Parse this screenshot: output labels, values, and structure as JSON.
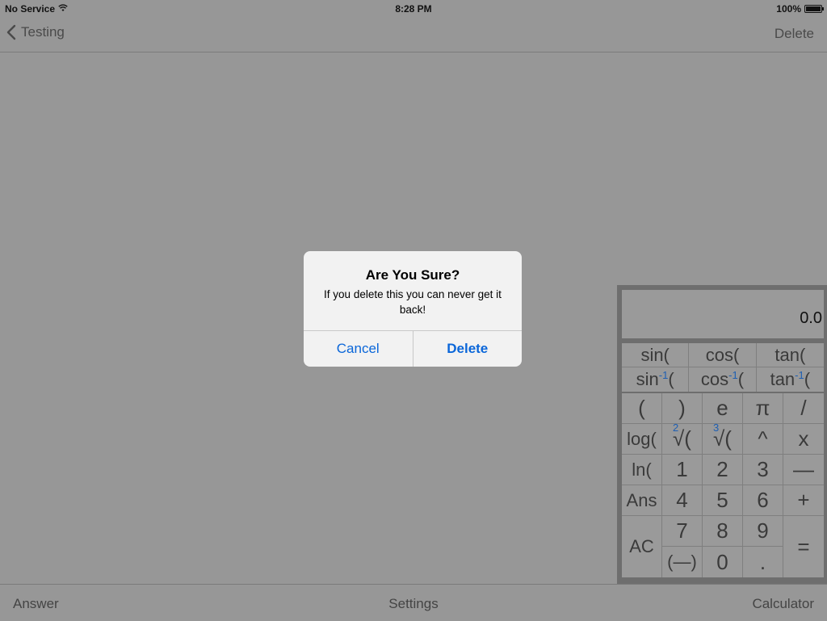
{
  "status_bar": {
    "carrier": "No Service",
    "time": "8:28 PM",
    "battery": "100%"
  },
  "nav": {
    "back_label": "Testing",
    "right_action": "Delete"
  },
  "calculator": {
    "display": "0.0",
    "trig": [
      {
        "fn": "sin(",
        "sup": ""
      },
      {
        "fn": "cos(",
        "sup": ""
      },
      {
        "fn": "tan(",
        "sup": ""
      },
      {
        "fn": "sin",
        "sup": "-1",
        "tail": "("
      },
      {
        "fn": "cos",
        "sup": "-1",
        "tail": "("
      },
      {
        "fn": "tan",
        "sup": "-1",
        "tail": "("
      }
    ],
    "keys": {
      "lparen": "(",
      "rparen": ")",
      "e": "e",
      "pi": "π",
      "divide": "/",
      "log": "log(",
      "sqrt2_index": "2",
      "sqrt2": "√(",
      "sqrt3_index": "3",
      "sqrt3": "√(",
      "power": "^",
      "multiply": "x",
      "ln": "ln(",
      "one": "1",
      "two": "2",
      "three": "3",
      "minus": "—",
      "ans": "Ans",
      "four": "4",
      "five": "5",
      "six": "6",
      "plus": "+",
      "ac": "AC",
      "seven": "7",
      "eight": "8",
      "nine": "9",
      "equals": "=",
      "negate": "(—)",
      "zero": "0",
      "decimal": "."
    }
  },
  "tabs": {
    "left": "Answer",
    "center": "Settings",
    "right": "Calculator"
  },
  "alert": {
    "title": "Are You Sure?",
    "message": "If you delete this you can never get it back!",
    "cancel_label": "Cancel",
    "confirm_label": "Delete"
  },
  "colors": {
    "background": "#979797",
    "link_blue": "#0a66d9",
    "sup_blue": "#1e5fb3"
  }
}
